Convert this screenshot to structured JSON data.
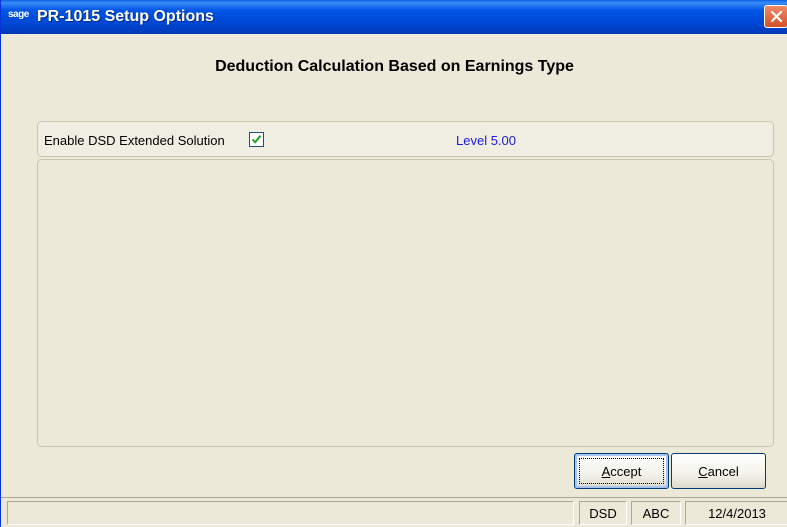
{
  "window": {
    "logo_text": "sage",
    "title": "PR-1015 Setup Options"
  },
  "header": {
    "title": "Deduction Calculation Based on Earnings Type"
  },
  "options": {
    "enable_label": "Enable DSD Extended Solution",
    "enable_checked": true,
    "level_text": "Level 5.00"
  },
  "buttons": {
    "accept_label": "Accept",
    "accept_mnemonic": "A",
    "accept_rest": "ccept",
    "cancel_label": "Cancel",
    "cancel_mnemonic": "C",
    "cancel_rest": "ancel"
  },
  "statusbar": {
    "main": "",
    "company": "DSD",
    "user": "ABC",
    "date": "12/4/2013"
  },
  "colors": {
    "titlebar": "#0055e5",
    "level_text": "#1a1adb",
    "checkmark": "#21a121",
    "close_button": "#d4502a"
  },
  "icons": {
    "close": "close-icon",
    "checkmark": "checkmark-icon"
  }
}
